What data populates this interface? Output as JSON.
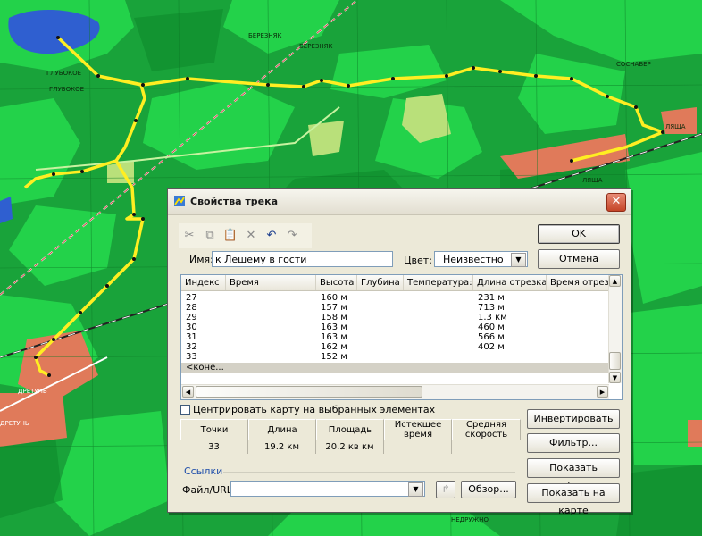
{
  "map": {
    "labels": [
      {
        "text": "ГЛУБОКОЕ",
        "white": false
      },
      {
        "text": "ГЛУБОКОЕ",
        "white": false
      },
      {
        "text": "БЕРЕЗНЯК",
        "white": false
      },
      {
        "text": "БЕРЕЗНЯК",
        "white": false
      },
      {
        "text": "СОСНАБЕР",
        "white": false
      },
      {
        "text": "ЛЯЩА",
        "white": false
      },
      {
        "text": "ЛЯЩА",
        "white": false
      },
      {
        "text": "ДРЕТУНЬ",
        "white": true
      },
      {
        "text": "ДРЕТУНЬ",
        "white": true
      },
      {
        "text": "НЕДРУЖНО",
        "white": false
      }
    ],
    "track_color": "#ffee22",
    "forest_color": "#19a33a",
    "meadow_color": "#23d24a",
    "water_color": "#2f5fd0",
    "settlement_color": "#e07a5a"
  },
  "dialog": {
    "title": "Свойства трека",
    "close_label": "✕",
    "toolbar": {
      "icons": [
        "cut-icon",
        "copy-icon",
        "paste-icon",
        "delete-icon",
        "undo-icon",
        "redo-icon"
      ]
    },
    "name_label": "Имя:",
    "name_value": "к Лешему в гости",
    "color_label": "Цвет:",
    "color_value": "Неизвестно",
    "ok_label": "OK",
    "cancel_label": "Отмена",
    "table": {
      "headers": [
        "Индекс",
        "Время",
        "Высота",
        "Глубина",
        "Температура:",
        "Длина отрезка",
        "Время отрезка"
      ],
      "rows": [
        {
          "index": "27",
          "altitude": "160 м",
          "length": "231 м"
        },
        {
          "index": "28",
          "altitude": "157 м",
          "length": "713 м"
        },
        {
          "index": "29",
          "altitude": "158 м",
          "length": "1.3 км"
        },
        {
          "index": "30",
          "altitude": "163 м",
          "length": "460 м"
        },
        {
          "index": "31",
          "altitude": "163 м",
          "length": "566 м"
        },
        {
          "index": "32",
          "altitude": "162 м",
          "length": "402 м"
        },
        {
          "index": "33",
          "altitude": "152 м",
          "length": ""
        }
      ],
      "end_row": "<коне..."
    },
    "center_map_label": "Центрировать карту на выбранных элементах",
    "invert_label": "Инвертировать",
    "filter_label": "Фильтр...",
    "profile_label": "Показать профиль...",
    "show_on_map_label": "Показать на карте",
    "stats": {
      "headers": [
        "Точки",
        "Длина",
        "Площадь",
        "Истекшее время",
        "Средняя скорость"
      ],
      "values": [
        "33",
        "19.2 км",
        "20.2 кв км",
        "",
        ""
      ]
    },
    "links_title": "Ссылки",
    "file_url_label": "Файл/URL:",
    "file_url_value": "",
    "browse_label": "Обзор..."
  }
}
